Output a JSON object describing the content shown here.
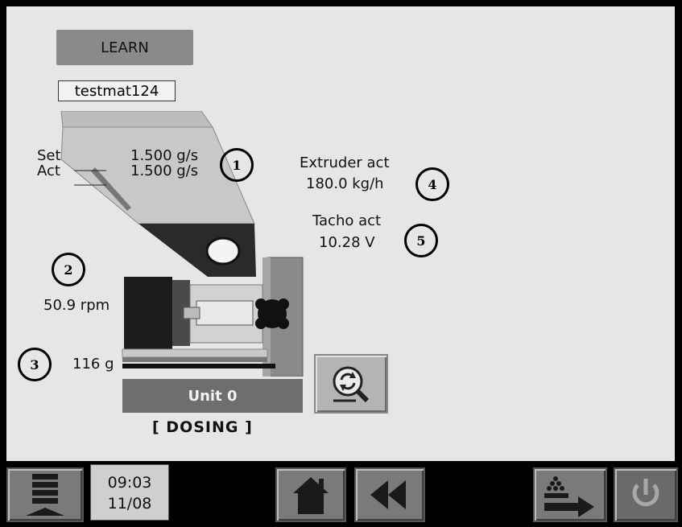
{
  "learn_button": {
    "label": "LEARN"
  },
  "material": {
    "name": "testmat124"
  },
  "feed_rate": {
    "set_label": "Set",
    "set_value": "1.500 g/s",
    "act_label": "Act",
    "act_value": "1.500 g/s"
  },
  "extruder": {
    "label": "Extruder act",
    "value": "180.0 kg/h"
  },
  "tacho": {
    "label": "Tacho act",
    "value": "10.28 V"
  },
  "motor": {
    "speed": "50.9 rpm"
  },
  "weight": {
    "value": "116 g"
  },
  "unit": {
    "label": "Unit 0",
    "status": "[ DOSING ]"
  },
  "callouts": [
    "1",
    "2",
    "3",
    "4",
    "5"
  ],
  "clock": {
    "time": "09:03",
    "date": "11/08"
  },
  "icons": {
    "menu": "menu-stack-icon",
    "home": "home-icon",
    "back": "rewind-icon",
    "transfer": "material-transfer-icon",
    "power": "power-icon",
    "zoom": "zoom-refresh-icon"
  }
}
